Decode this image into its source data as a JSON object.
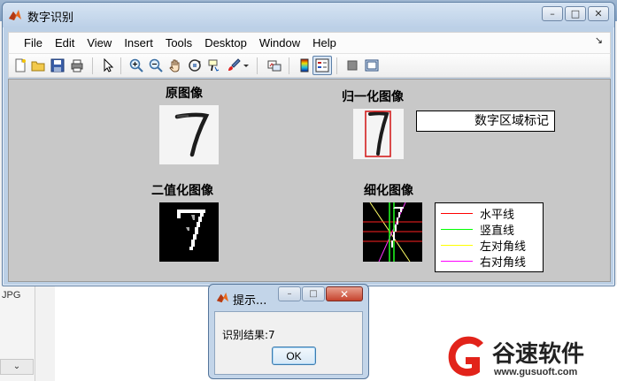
{
  "window": {
    "title": "数字识别",
    "menu": [
      "File",
      "Edit",
      "View",
      "Insert",
      "Tools",
      "Desktop",
      "Window",
      "Help"
    ],
    "toolbar_icons": [
      "new-file-icon",
      "open-folder-icon",
      "save-icon",
      "print-icon",
      "pointer-icon",
      "zoom-in-icon",
      "zoom-out-icon",
      "pan-hand-icon",
      "rotate-3d-icon",
      "data-cursor-icon",
      "brush-icon",
      "brush-dropdown-icon",
      "link-plot-icon",
      "colorbar-icon",
      "legend-icon",
      "hide-plot-tools-icon",
      "show-plot-tools-icon"
    ]
  },
  "figure": {
    "original": {
      "title": "原图像"
    },
    "normalized": {
      "title": "归一化图像",
      "tag_label": "数字区域标记"
    },
    "binary": {
      "title": "二值化图像"
    },
    "thinned": {
      "title": "细化图像",
      "legend": [
        {
          "label": "水平线",
          "color": "#ff0000"
        },
        {
          "label": "竖直线",
          "color": "#00ff00"
        },
        {
          "label": "左对角线",
          "color": "#ffff00"
        },
        {
          "label": "右对角线",
          "color": "#ff00ff"
        }
      ]
    }
  },
  "dialog": {
    "title": "提示...",
    "message": "识别结果:7",
    "ok_label": "OK"
  },
  "background": {
    "left_pane_text": "JPG"
  },
  "watermark": {
    "name": "谷速软件",
    "url": "www.gusuoft.com"
  }
}
